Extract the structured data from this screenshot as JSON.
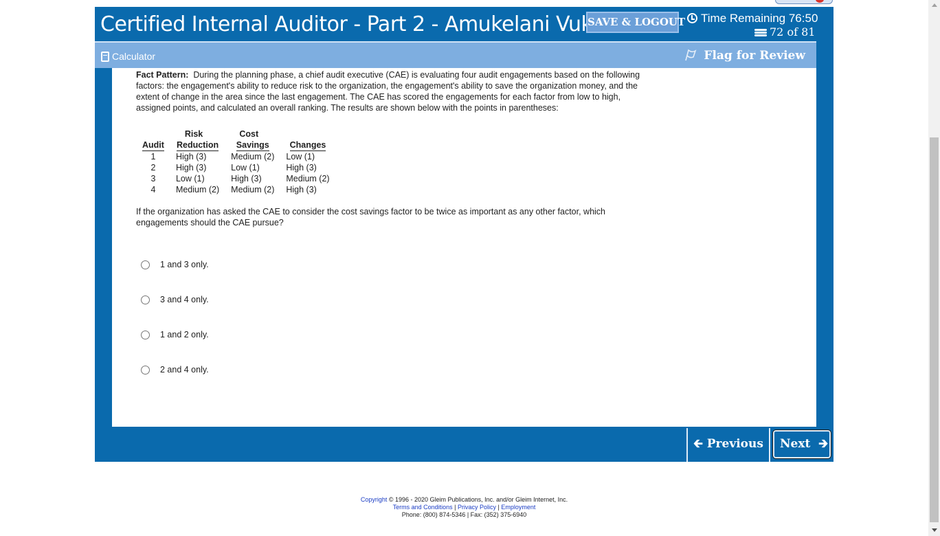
{
  "header": {
    "title": "Certified Internal Auditor - Part 2 - Amukelani Vukela",
    "save_logout": "SAVE & LOGOUT",
    "time_remaining": "Time Remaining 76:50",
    "question_counter": "72 of 81"
  },
  "toolbar": {
    "calculator": "Calculator",
    "flag_for_review": "Flag for Review"
  },
  "question": {
    "fact_pattern_label": "Fact Pattern:",
    "fact_pattern_text": "During the planning phase, a chief audit executive (CAE) is evaluating four audit engagements based on the following factors:  the engagement's ability to reduce risk to the organization, the engagement's ability to save the organization money, and the extent of change in the area since the last engagement. The CAE has scored the engagements for each factor from low to high, assigned points, and calculated an overall ranking. The results are shown below with the points in parentheses:",
    "table": {
      "headers": {
        "audit": "Audit",
        "risk_top": "Risk",
        "risk_bottom": "Reduction",
        "cost_top": "Cost",
        "cost_bottom": "Savings",
        "changes": "Changes"
      },
      "rows": [
        {
          "audit": "1",
          "risk": "High (3)",
          "cost": "Medium (2)",
          "changes": "Low (1)"
        },
        {
          "audit": "2",
          "risk": "High (3)",
          "cost": "Low (1)",
          "changes": "High (3)"
        },
        {
          "audit": "3",
          "risk": "Low (1)",
          "cost": "High (3)",
          "changes": "Medium (2)"
        },
        {
          "audit": "4",
          "risk": "Medium (2)",
          "cost": "Medium (2)",
          "changes": "High (3)"
        }
      ]
    },
    "stem": "If the organization has asked the CAE to consider the cost savings factor to be twice as important as any other factor, which engagements should the CAE pursue?",
    "options": [
      {
        "label": "1 and 3 only."
      },
      {
        "label": "3 and 4 only."
      },
      {
        "label": "1 and 2 only."
      },
      {
        "label": "2 and 4 only."
      }
    ]
  },
  "navigation": {
    "previous": "Previous",
    "next": "Next"
  },
  "footer": {
    "copyright_link": "Copyright",
    "copyright_text": " © 1996 - 2020 Gleim Publications, Inc. and/or Gleim Internet, Inc.",
    "terms": "Terms and Conditions",
    "privacy": "Privacy Policy",
    "employment": "Employment",
    "separator": " | ",
    "contact": "Phone: (800) 874-5346 | Fax: (352) 375-6940"
  },
  "colors": {
    "primary_blue": "#0a6aad",
    "toolbar_blue": "#7eaee0",
    "save_button": "#6b9fd8"
  }
}
